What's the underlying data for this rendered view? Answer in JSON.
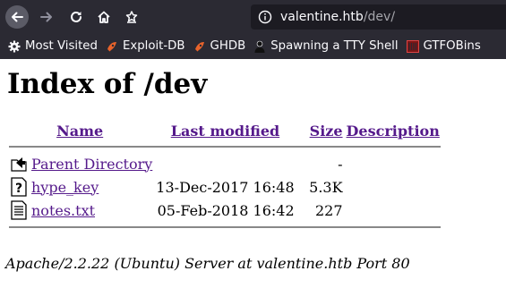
{
  "browser": {
    "url_host": "valentine.htb",
    "url_path": "/dev/"
  },
  "bookmarks": [
    {
      "label": "Most Visited",
      "icon": "gear-icon"
    },
    {
      "label": "Exploit-DB",
      "icon": "exploit-db-icon"
    },
    {
      "label": "GHDB",
      "icon": "ghdb-icon"
    },
    {
      "label": "Spawning a TTY Shell",
      "icon": "terminal-user-icon"
    },
    {
      "label": "GTFOBins",
      "icon": "gtfobins-icon"
    }
  ],
  "page": {
    "title": "Index of /dev",
    "columns": {
      "name": "Name",
      "last_modified": "Last modified",
      "size": "Size",
      "description": "Description"
    },
    "entries": [
      {
        "name": "Parent Directory",
        "modified": "",
        "size": "-",
        "icon": "back-folder-icon"
      },
      {
        "name": "hype_key",
        "modified": "13-Dec-2017 16:48",
        "size": "5.3K",
        "icon": "unknown-file-icon"
      },
      {
        "name": "notes.txt",
        "modified": "05-Feb-2018 16:42",
        "size": "227",
        "icon": "text-file-icon"
      }
    ],
    "server_signature": "Apache/2.2.22 (Ubuntu) Server at valentine.htb Port 80"
  },
  "colors": {
    "chrome_bg": "#2b2a33",
    "urlbar_bg": "#1c1b22",
    "link_visited": "#551a8b"
  }
}
